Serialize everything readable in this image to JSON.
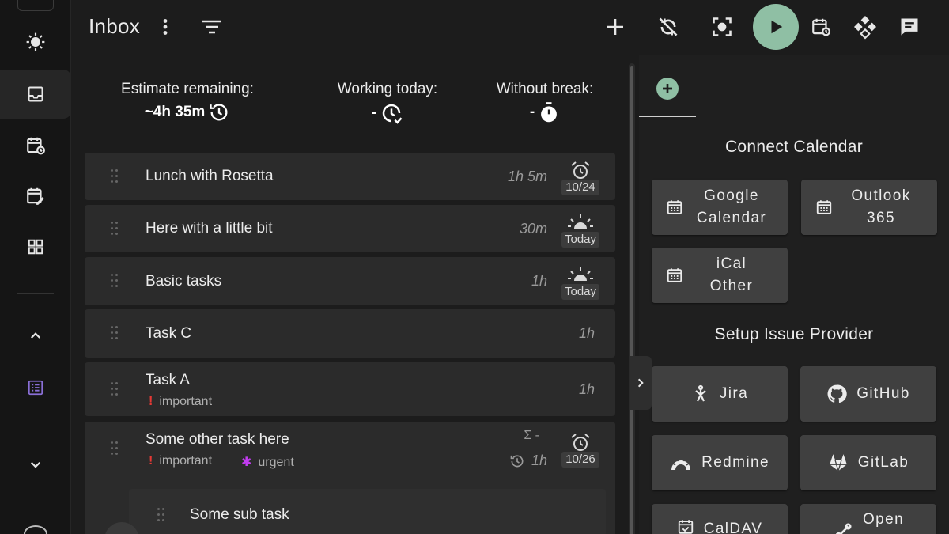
{
  "header": {
    "title": "Inbox"
  },
  "stats": {
    "estimate_label": "Estimate remaining:",
    "estimate_value": "~4h 35m",
    "working_label": "Working today:",
    "working_value": "-",
    "break_label": "Without break:",
    "break_value": "-"
  },
  "tasks": [
    {
      "title": "Lunch with Rosetta",
      "time": "1h 5m",
      "schedule": "10/24",
      "schedule_icon": "alarm-icon"
    },
    {
      "title": "Here with a little bit",
      "time": "30m",
      "schedule": "Today",
      "schedule_icon": "sunrise-icon"
    },
    {
      "title": "Basic tasks",
      "time": "1h",
      "schedule": "Today",
      "schedule_icon": "sunrise-icon"
    },
    {
      "title": "Task C",
      "time": "1h"
    },
    {
      "title": "Task A",
      "time": "1h",
      "tags": [
        {
          "mark": "!",
          "label": "important"
        }
      ]
    },
    {
      "title": "Some other task here",
      "sum_label": "Σ -",
      "time": "1h",
      "schedule": "10/26",
      "schedule_icon": "alarm-icon",
      "tags": [
        {
          "mark": "!",
          "label": "important"
        },
        {
          "mark": "✱",
          "label": "urgent"
        }
      ]
    }
  ],
  "subtask": {
    "title": "Some sub task"
  },
  "side": {
    "calendar_title": "Connect Calendar",
    "calendar_buttons": [
      {
        "label_line1": "Google",
        "label_line2": "Calendar"
      },
      {
        "label_line1": "Outlook",
        "label_line2": "365"
      },
      {
        "label_line1": "iCal",
        "label_line2": "Other"
      }
    ],
    "issue_title": "Setup Issue Provider",
    "issue_buttons": [
      {
        "label": "Jira"
      },
      {
        "label": "GitHub"
      },
      {
        "label": "Redmine"
      },
      {
        "label": "GitLab"
      },
      {
        "label": "CalDAV"
      },
      {
        "label": "Open"
      }
    ]
  },
  "colors": {
    "accent": "#8fbfa4",
    "important": "#e53935",
    "urgent": "#c23cf0",
    "project_icon": "#8a6fd6"
  }
}
